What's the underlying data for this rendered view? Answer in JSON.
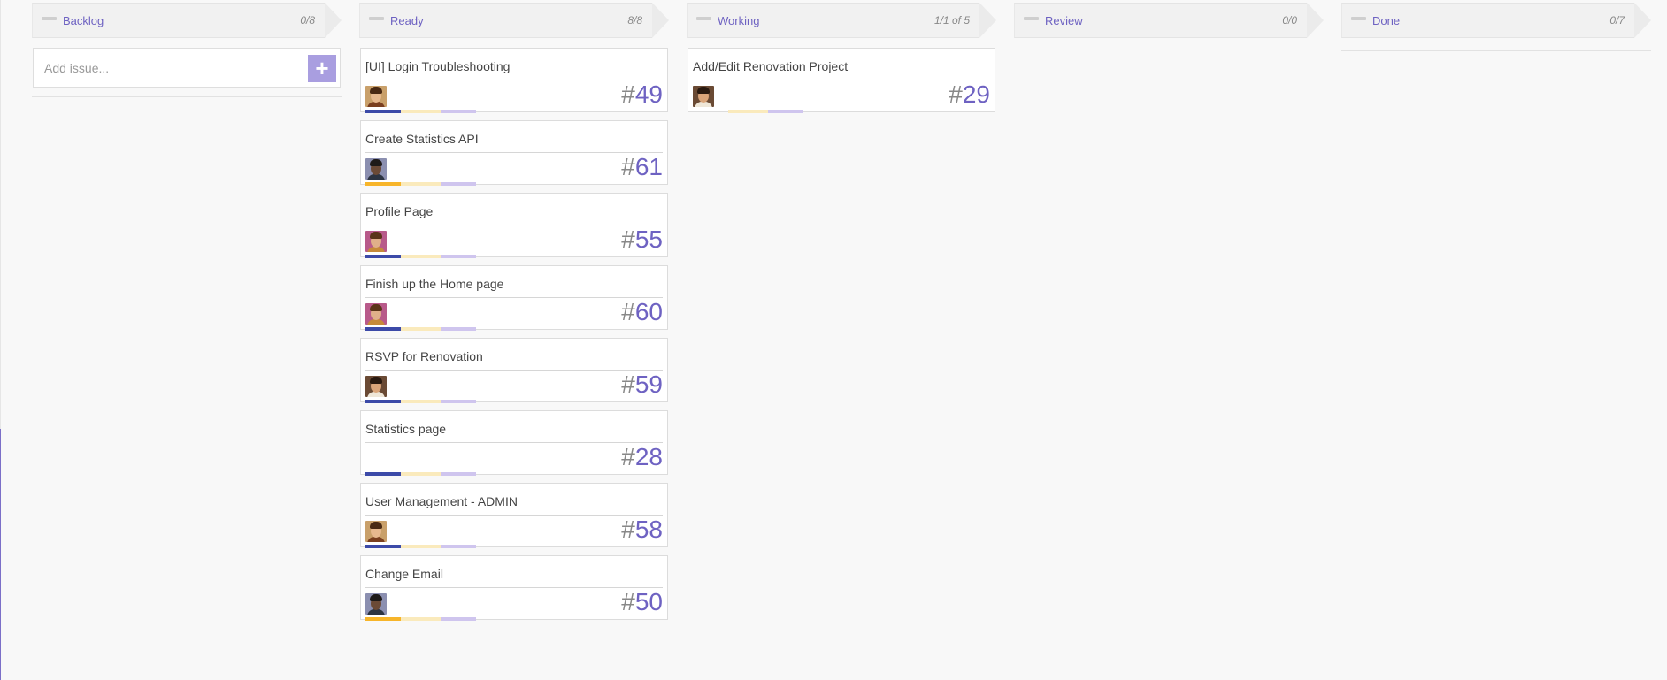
{
  "colors": {
    "accent": "#6e62c2",
    "priority_blue": "#3c4aa8",
    "priority_orange": "#f7b52a",
    "bar_yellow": "#faeabc",
    "bar_lavender": "#cfc5ee",
    "add_button": "#a99ee0"
  },
  "columns": [
    {
      "title": "Backlog",
      "count": "0/8"
    },
    {
      "title": "Ready",
      "count": "8/8"
    },
    {
      "title": "Working",
      "count": "1/1 of 5"
    },
    {
      "title": "Review",
      "count": "0/0"
    },
    {
      "title": "Done",
      "count": "0/7"
    }
  ],
  "backlog": {
    "add_issue_placeholder": "Add issue...",
    "add_button_label": "+"
  },
  "ready_cards": [
    {
      "title": "[UI] Login Troubleshooting",
      "number": "49",
      "priority": "blue",
      "avatar": "user-a"
    },
    {
      "title": "Create Statistics API",
      "number": "61",
      "priority": "orange",
      "avatar": "user-b"
    },
    {
      "title": "Profile Page",
      "number": "55",
      "priority": "blue",
      "avatar": "user-c"
    },
    {
      "title": "Finish up the Home page",
      "number": "60",
      "priority": "blue",
      "avatar": "user-c"
    },
    {
      "title": "RSVP for Renovation",
      "number": "59",
      "priority": "blue",
      "avatar": "user-d"
    },
    {
      "title": "Statistics page",
      "number": "28",
      "priority": "blue",
      "avatar": ""
    },
    {
      "title": "User Management - ADMIN",
      "number": "58",
      "priority": "blue",
      "avatar": "user-a"
    },
    {
      "title": "Change Email",
      "number": "50",
      "priority": "orange",
      "avatar": "user-b"
    }
  ],
  "working_cards": [
    {
      "title": "Add/Edit Renovation Project",
      "number": "29",
      "priority": "none",
      "avatar": "user-d"
    }
  ],
  "hash": "#"
}
